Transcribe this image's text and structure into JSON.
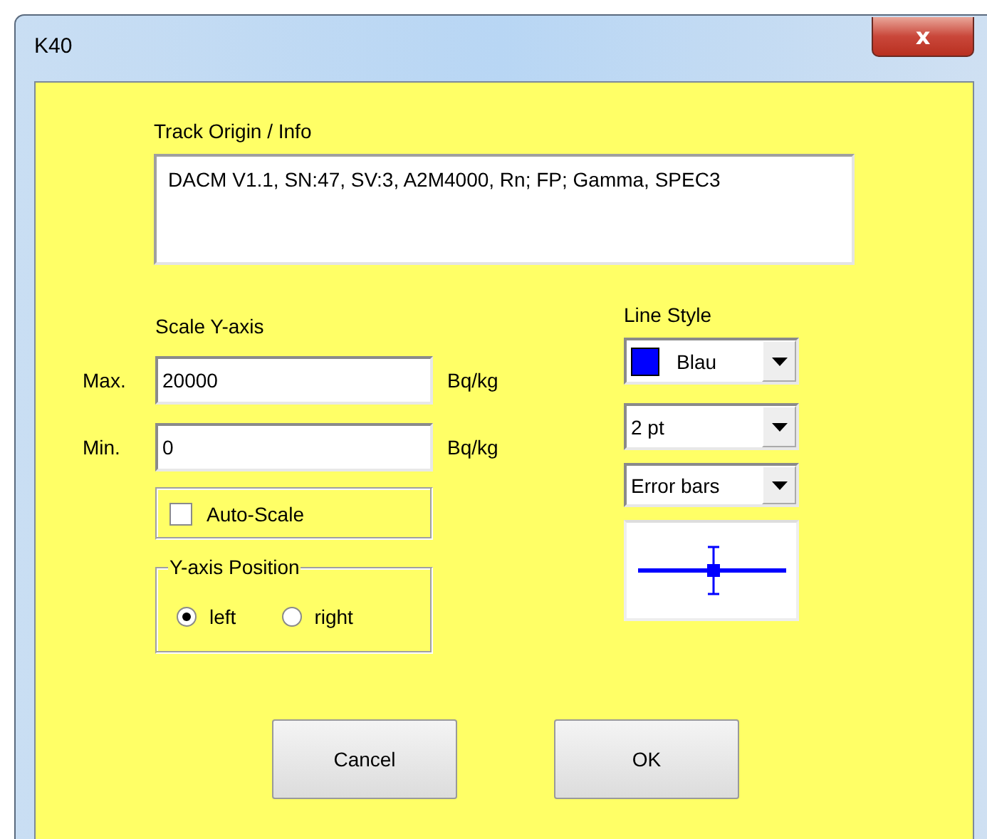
{
  "window": {
    "title": "K40",
    "close_label": "x"
  },
  "track_info": {
    "label": "Track Origin / Info",
    "value": "DACM V1.1, SN:47, SV:3, A2M4000, Rn; FP; Gamma, SPEC3"
  },
  "scale_y_axis": {
    "label": "Scale Y-axis",
    "fields": [
      {
        "label": "Max.",
        "value": "20000",
        "unit": "Bq/kg"
      },
      {
        "label": "Min.",
        "value": "0",
        "unit": "Bq/kg"
      }
    ],
    "auto_scale": {
      "label": "Auto-Scale",
      "checked": false
    }
  },
  "y_axis_position": {
    "label": "Y-axis Position",
    "options": [
      {
        "label": "left",
        "selected": true
      },
      {
        "label": "right",
        "selected": false
      }
    ]
  },
  "line_style": {
    "label": "Line Style",
    "combos": [
      {
        "kind": "color",
        "value": "Blau",
        "color": "#0000ff"
      },
      {
        "kind": "plain",
        "value": "2 pt"
      },
      {
        "kind": "plain",
        "value": "Error bars"
      }
    ]
  },
  "buttons": [
    "Cancel",
    "OK"
  ]
}
